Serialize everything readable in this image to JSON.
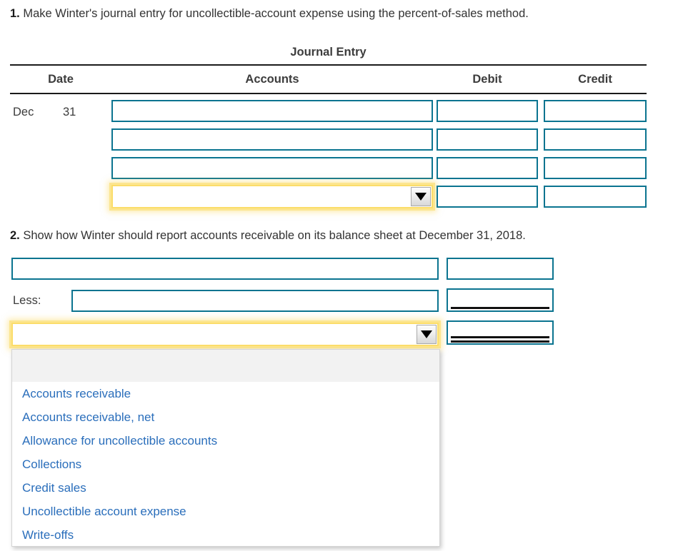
{
  "questions": {
    "q1": {
      "number": "1.",
      "text": "Make Winter's journal entry for uncollectible-account expense using the percent-of-sales method."
    },
    "q2": {
      "number": "2.",
      "text": "Show how Winter should report accounts receivable on its balance sheet at December 31, 2018."
    }
  },
  "journal_entry": {
    "title": "Journal Entry",
    "columns": {
      "date": "Date",
      "accounts": "Accounts",
      "debit": "Debit",
      "credit": "Credit"
    },
    "date": {
      "month": "Dec",
      "day": "31"
    },
    "rows": [
      {
        "accounts": "",
        "debit": "",
        "credit": "",
        "type": "text"
      },
      {
        "accounts": "",
        "debit": "",
        "credit": "",
        "type": "text"
      },
      {
        "accounts": "",
        "debit": "",
        "credit": "",
        "type": "text"
      },
      {
        "accounts": "",
        "debit": "",
        "credit": "",
        "type": "select",
        "focused": true
      }
    ]
  },
  "balance_sheet": {
    "rows": [
      {
        "label": "",
        "value": "",
        "type": "text",
        "underline": "none"
      },
      {
        "label": "Less:",
        "value": "",
        "type": "text",
        "underline": "single"
      },
      {
        "label": "",
        "value": "",
        "type": "select",
        "underline": "double",
        "focused": true
      }
    ]
  },
  "dropdown": {
    "open": true,
    "selected": "",
    "blank_option": "",
    "options": [
      "Accounts receivable",
      "Accounts receivable, net",
      "Allowance for uncollectible accounts",
      "Collections",
      "Credit sales",
      "Uncollectible account expense",
      "Write-offs"
    ]
  },
  "colors": {
    "field_border": "#0b7490",
    "focus_ring": "#f7d74e",
    "option_text": "#2a6ebb",
    "rule": "#1a1a1a",
    "blank_option_bg": "#f2f2f2"
  }
}
